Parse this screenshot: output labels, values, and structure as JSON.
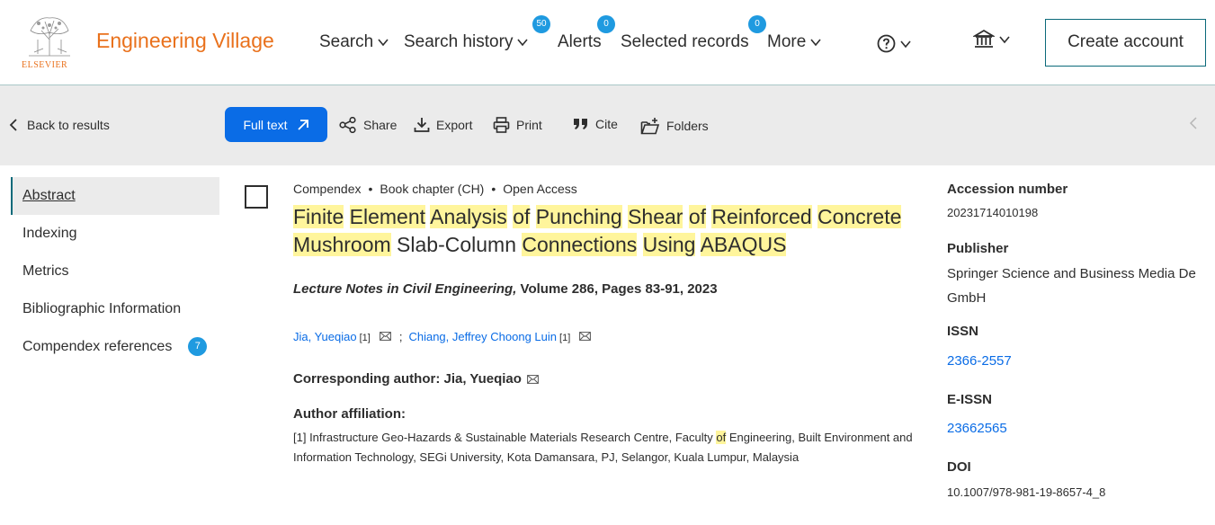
{
  "header": {
    "brand": "Engineering Village",
    "logo_text": "ELSEVIER",
    "nav": {
      "search": "Search",
      "search_history": "Search history",
      "search_history_badge": "50",
      "alerts": "Alerts",
      "alerts_badge": "0",
      "selected_records": "Selected records",
      "selected_records_badge": "0",
      "more": "More"
    },
    "create_account": "Create account"
  },
  "toolbar": {
    "back": "Back to results",
    "full_text": "Full text",
    "share": "Share",
    "export": "Export",
    "print": "Print",
    "cite": "Cite",
    "folders": "Folders"
  },
  "sidebar": {
    "items": [
      {
        "label": "Abstract"
      },
      {
        "label": "Indexing"
      },
      {
        "label": "Metrics"
      },
      {
        "label": "Bibliographic Information"
      },
      {
        "label": "Compendex references",
        "badge": "7"
      }
    ]
  },
  "record": {
    "database": "Compendex",
    "doc_type": "Book chapter (CH)",
    "access": "Open Access",
    "title_segments": [
      {
        "t": "Finite",
        "h": true
      },
      {
        "t": " ",
        "h": false
      },
      {
        "t": "Element",
        "h": true
      },
      {
        "t": " ",
        "h": false
      },
      {
        "t": "Analysis",
        "h": true
      },
      {
        "t": " ",
        "h": false
      },
      {
        "t": "of",
        "h": true
      },
      {
        "t": " ",
        "h": false
      },
      {
        "t": "Punching",
        "h": true
      },
      {
        "t": " ",
        "h": false
      },
      {
        "t": "Shear",
        "h": true
      },
      {
        "t": " ",
        "h": false
      },
      {
        "t": "of",
        "h": true
      },
      {
        "t": " ",
        "h": false
      },
      {
        "t": "Reinforced",
        "h": true
      },
      {
        "t": " ",
        "h": false
      },
      {
        "t": "Concrete",
        "h": true
      },
      {
        "t": " ",
        "h": false
      },
      {
        "t": "Mushroom",
        "h": true
      },
      {
        "t": " Slab-Column ",
        "h": false
      },
      {
        "t": "Connections",
        "h": true
      },
      {
        "t": " ",
        "h": false
      },
      {
        "t": "Using",
        "h": true
      },
      {
        "t": " ",
        "h": false
      },
      {
        "t": "ABAQUS",
        "h": true
      }
    ],
    "series": "Lecture Notes in Civil Engineering,",
    "volume_pages": " Volume 286, Pages 83-91, 2023",
    "authors": [
      {
        "name": "Jia, Yueqiao",
        "sup": "[1]"
      },
      {
        "name": "Chiang, Jeffrey Choong Luin",
        "sup": "[1]"
      }
    ],
    "author_sep": ";",
    "corresponding": "Corresponding author: Jia, Yueqiao",
    "affiliation_label": "Author affiliation:",
    "affiliation_pre": "[1] Infrastructure Geo-Hazards & Sustainable Materials Research Centre, Faculty ",
    "affiliation_hl": "of",
    "affiliation_post": " Engineering, Built Environment and Information Technology, SEGi University, Kota Damansara, PJ, Selangor, Kuala Lumpur, Malaysia"
  },
  "details": {
    "accession_label": "Accession number",
    "accession": "20231714010198",
    "publisher_label": "Publisher",
    "publisher": "Springer Science and Business Media De GmbH",
    "issn_label": "ISSN",
    "issn": "2366-2557",
    "eissn_label": "E-ISSN",
    "eissn": "23662565",
    "doi_label": "DOI",
    "doi": "10.1007/978-981-19-8657-4_8"
  },
  "colors": {
    "brand": "#e9711c",
    "accent": "#0a6ce6",
    "badge": "#1f9ae0",
    "highlight": "#fff59c"
  }
}
